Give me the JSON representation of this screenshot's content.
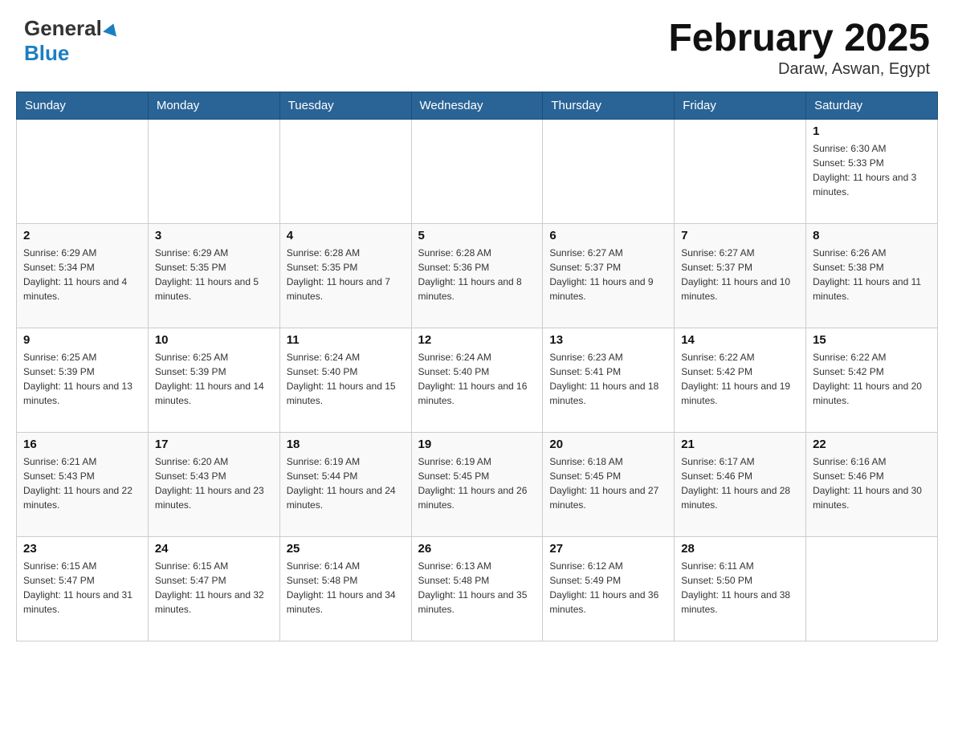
{
  "header": {
    "logo_general": "General",
    "logo_blue": "Blue",
    "month_title": "February 2025",
    "location": "Daraw, Aswan, Egypt"
  },
  "days_of_week": [
    "Sunday",
    "Monday",
    "Tuesday",
    "Wednesday",
    "Thursday",
    "Friday",
    "Saturday"
  ],
  "weeks": [
    [
      {
        "day": "",
        "info": ""
      },
      {
        "day": "",
        "info": ""
      },
      {
        "day": "",
        "info": ""
      },
      {
        "day": "",
        "info": ""
      },
      {
        "day": "",
        "info": ""
      },
      {
        "day": "",
        "info": ""
      },
      {
        "day": "1",
        "info": "Sunrise: 6:30 AM\nSunset: 5:33 PM\nDaylight: 11 hours and 3 minutes."
      }
    ],
    [
      {
        "day": "2",
        "info": "Sunrise: 6:29 AM\nSunset: 5:34 PM\nDaylight: 11 hours and 4 minutes."
      },
      {
        "day": "3",
        "info": "Sunrise: 6:29 AM\nSunset: 5:35 PM\nDaylight: 11 hours and 5 minutes."
      },
      {
        "day": "4",
        "info": "Sunrise: 6:28 AM\nSunset: 5:35 PM\nDaylight: 11 hours and 7 minutes."
      },
      {
        "day": "5",
        "info": "Sunrise: 6:28 AM\nSunset: 5:36 PM\nDaylight: 11 hours and 8 minutes."
      },
      {
        "day": "6",
        "info": "Sunrise: 6:27 AM\nSunset: 5:37 PM\nDaylight: 11 hours and 9 minutes."
      },
      {
        "day": "7",
        "info": "Sunrise: 6:27 AM\nSunset: 5:37 PM\nDaylight: 11 hours and 10 minutes."
      },
      {
        "day": "8",
        "info": "Sunrise: 6:26 AM\nSunset: 5:38 PM\nDaylight: 11 hours and 11 minutes."
      }
    ],
    [
      {
        "day": "9",
        "info": "Sunrise: 6:25 AM\nSunset: 5:39 PM\nDaylight: 11 hours and 13 minutes."
      },
      {
        "day": "10",
        "info": "Sunrise: 6:25 AM\nSunset: 5:39 PM\nDaylight: 11 hours and 14 minutes."
      },
      {
        "day": "11",
        "info": "Sunrise: 6:24 AM\nSunset: 5:40 PM\nDaylight: 11 hours and 15 minutes."
      },
      {
        "day": "12",
        "info": "Sunrise: 6:24 AM\nSunset: 5:40 PM\nDaylight: 11 hours and 16 minutes."
      },
      {
        "day": "13",
        "info": "Sunrise: 6:23 AM\nSunset: 5:41 PM\nDaylight: 11 hours and 18 minutes."
      },
      {
        "day": "14",
        "info": "Sunrise: 6:22 AM\nSunset: 5:42 PM\nDaylight: 11 hours and 19 minutes."
      },
      {
        "day": "15",
        "info": "Sunrise: 6:22 AM\nSunset: 5:42 PM\nDaylight: 11 hours and 20 minutes."
      }
    ],
    [
      {
        "day": "16",
        "info": "Sunrise: 6:21 AM\nSunset: 5:43 PM\nDaylight: 11 hours and 22 minutes."
      },
      {
        "day": "17",
        "info": "Sunrise: 6:20 AM\nSunset: 5:43 PM\nDaylight: 11 hours and 23 minutes."
      },
      {
        "day": "18",
        "info": "Sunrise: 6:19 AM\nSunset: 5:44 PM\nDaylight: 11 hours and 24 minutes."
      },
      {
        "day": "19",
        "info": "Sunrise: 6:19 AM\nSunset: 5:45 PM\nDaylight: 11 hours and 26 minutes."
      },
      {
        "day": "20",
        "info": "Sunrise: 6:18 AM\nSunset: 5:45 PM\nDaylight: 11 hours and 27 minutes."
      },
      {
        "day": "21",
        "info": "Sunrise: 6:17 AM\nSunset: 5:46 PM\nDaylight: 11 hours and 28 minutes."
      },
      {
        "day": "22",
        "info": "Sunrise: 6:16 AM\nSunset: 5:46 PM\nDaylight: 11 hours and 30 minutes."
      }
    ],
    [
      {
        "day": "23",
        "info": "Sunrise: 6:15 AM\nSunset: 5:47 PM\nDaylight: 11 hours and 31 minutes."
      },
      {
        "day": "24",
        "info": "Sunrise: 6:15 AM\nSunset: 5:47 PM\nDaylight: 11 hours and 32 minutes."
      },
      {
        "day": "25",
        "info": "Sunrise: 6:14 AM\nSunset: 5:48 PM\nDaylight: 11 hours and 34 minutes."
      },
      {
        "day": "26",
        "info": "Sunrise: 6:13 AM\nSunset: 5:48 PM\nDaylight: 11 hours and 35 minutes."
      },
      {
        "day": "27",
        "info": "Sunrise: 6:12 AM\nSunset: 5:49 PM\nDaylight: 11 hours and 36 minutes."
      },
      {
        "day": "28",
        "info": "Sunrise: 6:11 AM\nSunset: 5:50 PM\nDaylight: 11 hours and 38 minutes."
      },
      {
        "day": "",
        "info": ""
      }
    ]
  ]
}
